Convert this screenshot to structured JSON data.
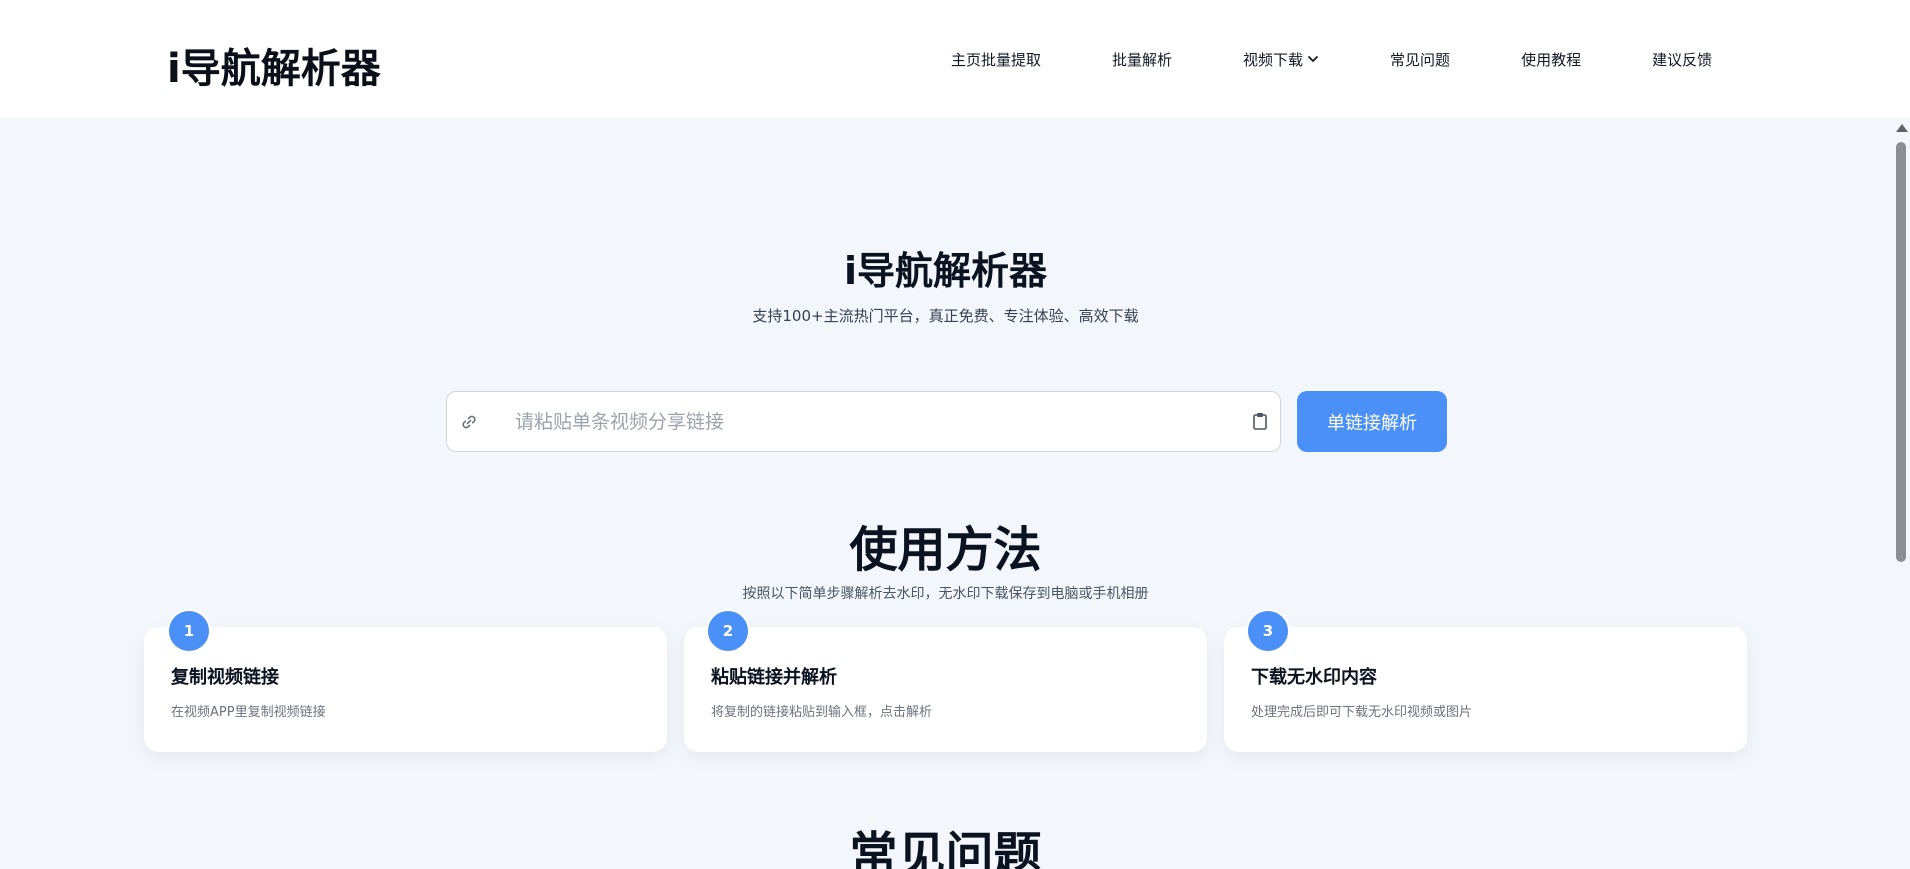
{
  "header": {
    "logo": "i导航解析器",
    "nav": [
      {
        "label": "主页批量提取"
      },
      {
        "label": "批量解析"
      },
      {
        "label": "视频下载",
        "has_dropdown": true
      },
      {
        "label": "常见问题"
      },
      {
        "label": "使用教程"
      },
      {
        "label": "建议反馈"
      }
    ]
  },
  "hero": {
    "title": "i导航解析器",
    "subtitle": "支持100+主流热门平台，真正免费、专注体验、高效下载"
  },
  "search": {
    "value": "",
    "placeholder": "请粘贴单条视频分享链接",
    "button_label": "单链接解析",
    "left_icon": "link-icon",
    "right_icon": "clipboard-icon"
  },
  "usage": {
    "title": "使用方法",
    "subtitle": "按照以下简单步骤解析去水印，无水印下载保存到电脑或手机相册",
    "steps": [
      {
        "number": "1",
        "title": "复制视频链接",
        "desc": "在视频APP里复制视频链接"
      },
      {
        "number": "2",
        "title": "粘贴链接并解析",
        "desc": "将复制的链接粘贴到输入框，点击解析"
      },
      {
        "number": "3",
        "title": "下载无水印内容",
        "desc": "处理完成后即可下载无水印视频或图片"
      }
    ]
  },
  "faq": {
    "title": "常见问题"
  },
  "colors": {
    "accent": "#4a90f7",
    "page_bg": "#f3f6fa",
    "header_bg": "#ffffff",
    "heading": "#0b1220"
  }
}
